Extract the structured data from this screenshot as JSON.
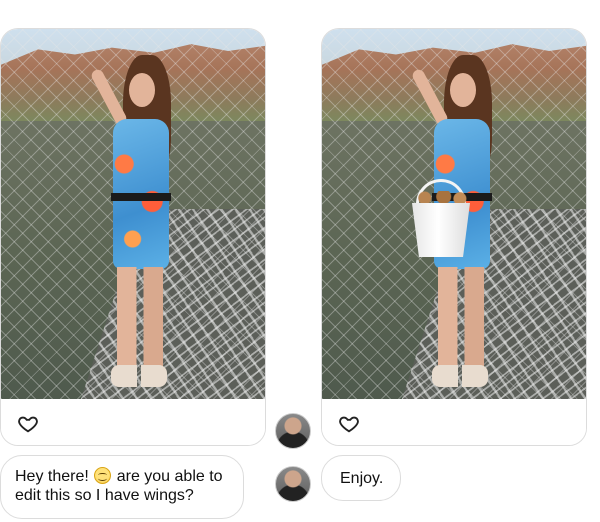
{
  "posts": {
    "original": {
      "photo_alt": "Woman in floral dress on a rope bridge",
      "like_icon": "heart-outline-icon"
    },
    "edited": {
      "photo_alt": "Same photo with a bucket of snacks added",
      "like_icon": "heart-outline-icon"
    }
  },
  "messages": {
    "question_part1": "Hey there! ",
    "question_emoji": "smiling-face-icon",
    "question_part2": " are you able to edit this so I have wings?",
    "reply": "Enjoy."
  },
  "colors": {
    "bubble_border": "#dcdcdc",
    "text": "#111111",
    "background": "#ffffff"
  }
}
